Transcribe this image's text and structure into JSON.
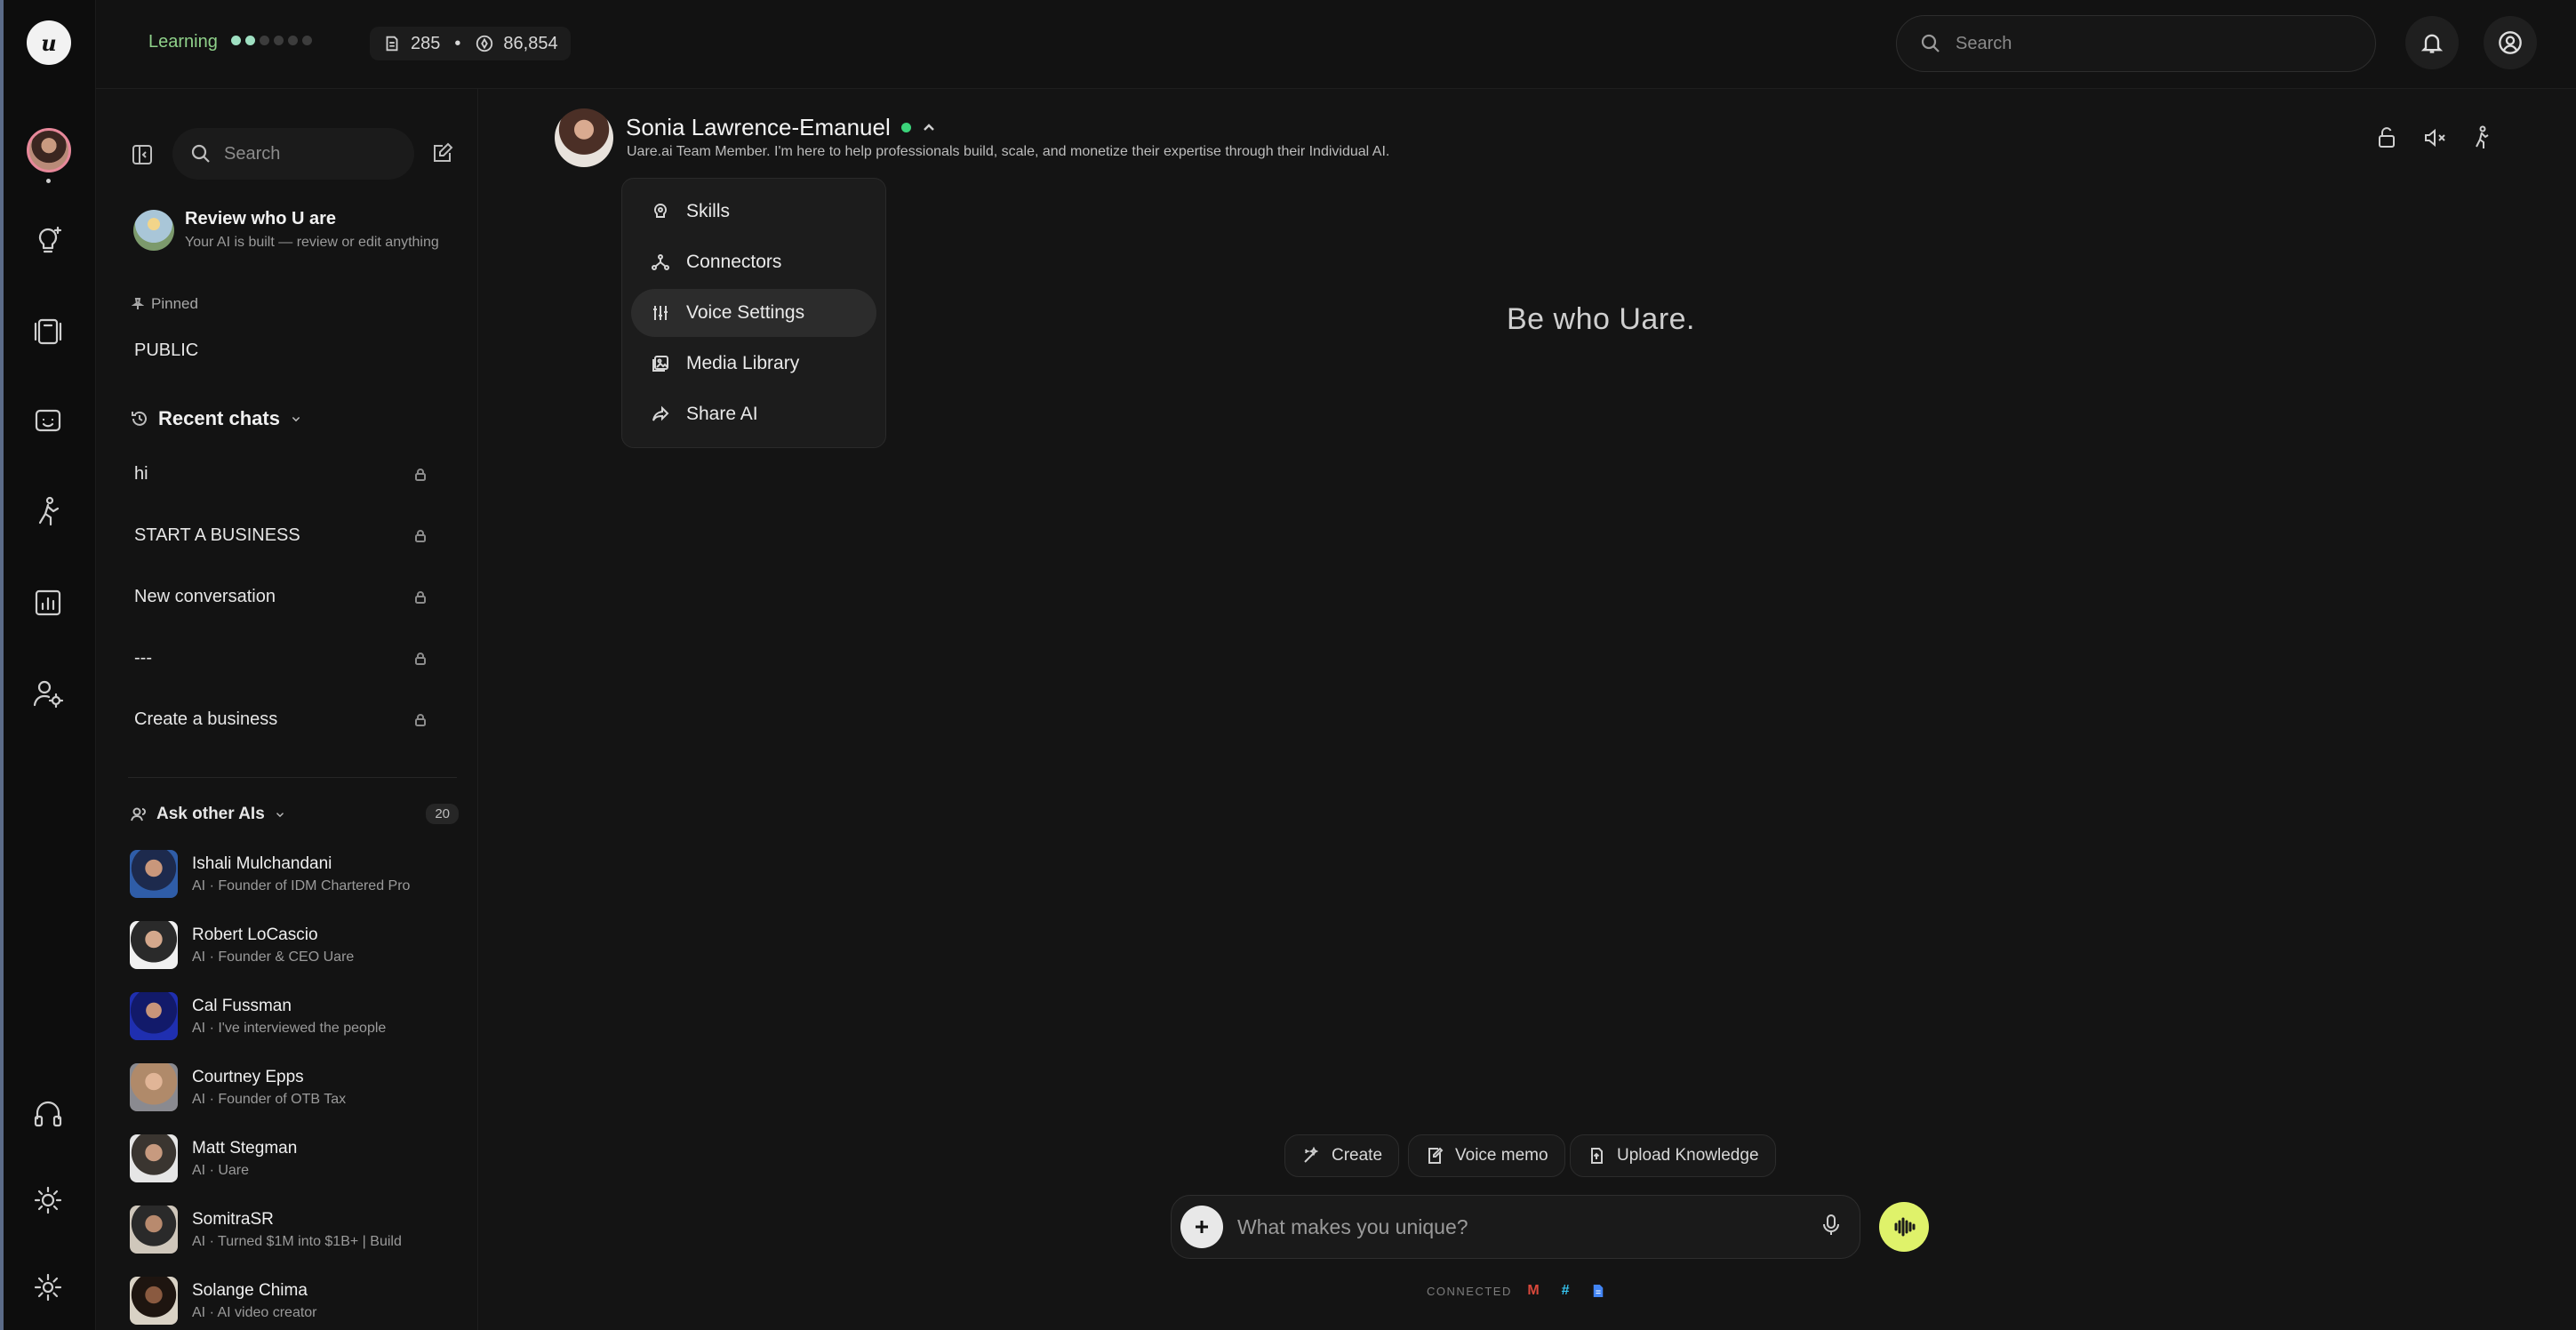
{
  "rail": {
    "logo": "u",
    "items": [
      "ideas-icon",
      "library-icon",
      "chat-icon",
      "activity-icon",
      "analytics-icon",
      "user-settings-icon"
    ],
    "bottom": [
      "headphones-icon",
      "sun-icon",
      "gear-icon"
    ]
  },
  "topbar": {
    "learning_label": "Learning",
    "stat_1": "285",
    "stat_separator": "•",
    "stat_2": "86,854",
    "search_placeholder": "Search"
  },
  "sidebar": {
    "search_placeholder": "Search",
    "review_title": "Review who U are",
    "review_subtitle": "Your AI is built — review or edit anything",
    "pinned_label": "Pinned",
    "pinned_item": "PUBLIC",
    "recent_label": "Recent chats",
    "chats": [
      "hi",
      "START A BUSINESS",
      "New conversation",
      "---",
      "Create a business"
    ],
    "ask_label": "Ask other AIs",
    "ask_count": "20",
    "people": [
      {
        "name": "Ishali Mulchandani",
        "desc": "AI · Founder of IDM Chartered Pro"
      },
      {
        "name": "Robert LoCascio",
        "desc": "AI · Founder & CEO Uare"
      },
      {
        "name": "Cal Fussman",
        "desc": "AI · I've interviewed the people"
      },
      {
        "name": "Courtney Epps",
        "desc": "AI · Founder of OTB Tax"
      },
      {
        "name": "Matt Stegman",
        "desc": "AI · Uare"
      },
      {
        "name": "SomitraSR",
        "desc": "AI · Turned $1M into $1B+ | Build"
      },
      {
        "name": "Solange Chima",
        "desc": "AI · AI video creator"
      }
    ]
  },
  "main": {
    "ai_name": "Sonia Lawrence-Emanuel",
    "ai_desc": "Uare.ai Team Member. I'm here to help professionals build, scale, and monetize their expertise through their Individual AI.",
    "menu": [
      "Skills",
      "Connectors",
      "Voice Settings",
      "Media Library",
      "Share AI"
    ],
    "tagline": "Be who Uare.",
    "quick_actions": [
      "Create",
      "Voice memo",
      "Upload Knowledge"
    ],
    "composer_placeholder": "What makes you unique?",
    "connected_label": "CONNECTED"
  },
  "colors": {
    "accent_green": "#8fd18a",
    "online": "#3bd37a",
    "voice_button": "#dff26a"
  }
}
